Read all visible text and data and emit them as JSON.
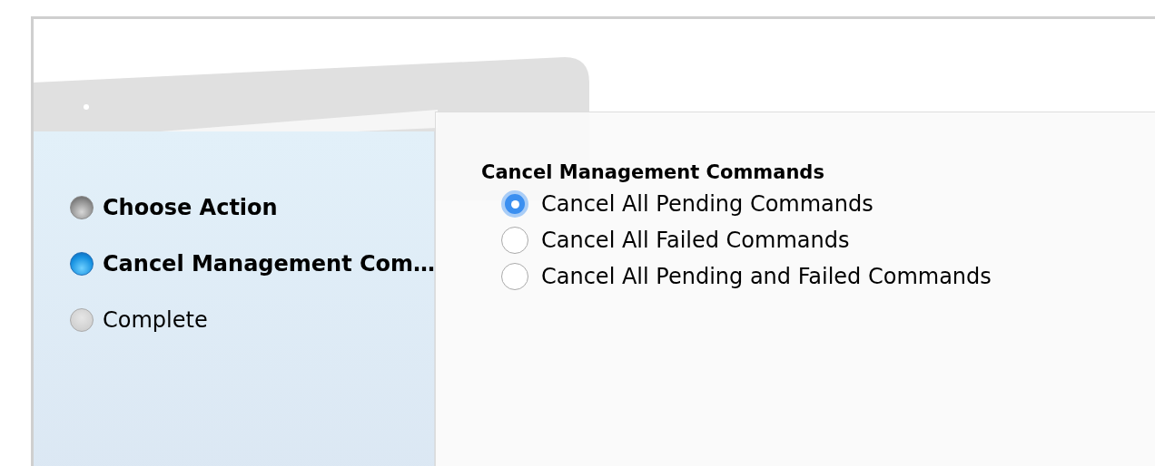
{
  "steps": [
    {
      "label": "Choose Action",
      "kind": "done"
    },
    {
      "label": "Cancel Management Com…",
      "kind": "current"
    },
    {
      "label": "Complete",
      "kind": "pending"
    }
  ],
  "options": {
    "title": "Cancel Management Commands",
    "items": [
      {
        "label": "Cancel All Pending Commands",
        "selected": true
      },
      {
        "label": "Cancel All Failed Commands",
        "selected": false
      },
      {
        "label": "Cancel All Pending and Failed Commands",
        "selected": false
      }
    ]
  }
}
